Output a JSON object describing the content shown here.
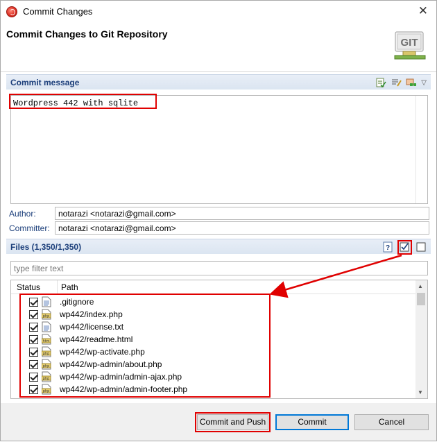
{
  "window": {
    "title": "Commit Changes"
  },
  "header": {
    "title": "Commit Changes to Git Repository",
    "logo_text": "GIT"
  },
  "commit_message": {
    "section_title": "Commit message",
    "text": "Wordpress 442 with sqlite"
  },
  "author": {
    "label": "Author:",
    "value": "notarazi <notarazi@gmail.com>"
  },
  "committer": {
    "label": "Committer:",
    "value": "notarazi <notarazi@gmail.com>"
  },
  "files": {
    "section_title": "Files (1,350/1,350)",
    "filter_placeholder": "type filter text",
    "columns": {
      "status": "Status",
      "path": "Path"
    },
    "rows": [
      {
        "path": ".gitignore",
        "icon": "text-file-icon"
      },
      {
        "path": "wp442/index.php",
        "icon": "php-file-icon"
      },
      {
        "path": "wp442/license.txt",
        "icon": "text-file-icon"
      },
      {
        "path": "wp442/readme.html",
        "icon": "html-file-icon"
      },
      {
        "path": "wp442/wp-activate.php",
        "icon": "php-file-icon"
      },
      {
        "path": "wp442/wp-admin/about.php",
        "icon": "php-file-icon"
      },
      {
        "path": "wp442/wp-admin/admin-ajax.php",
        "icon": "php-file-icon"
      },
      {
        "path": "wp442/wp-admin/admin-footer.php",
        "icon": "php-file-icon"
      }
    ]
  },
  "buttons": {
    "commit_and_push": "Commit and Push",
    "commit": "Commit",
    "cancel": "Cancel"
  },
  "colors": {
    "annotation": "#e00000",
    "section_title": "#1b3e7a"
  }
}
